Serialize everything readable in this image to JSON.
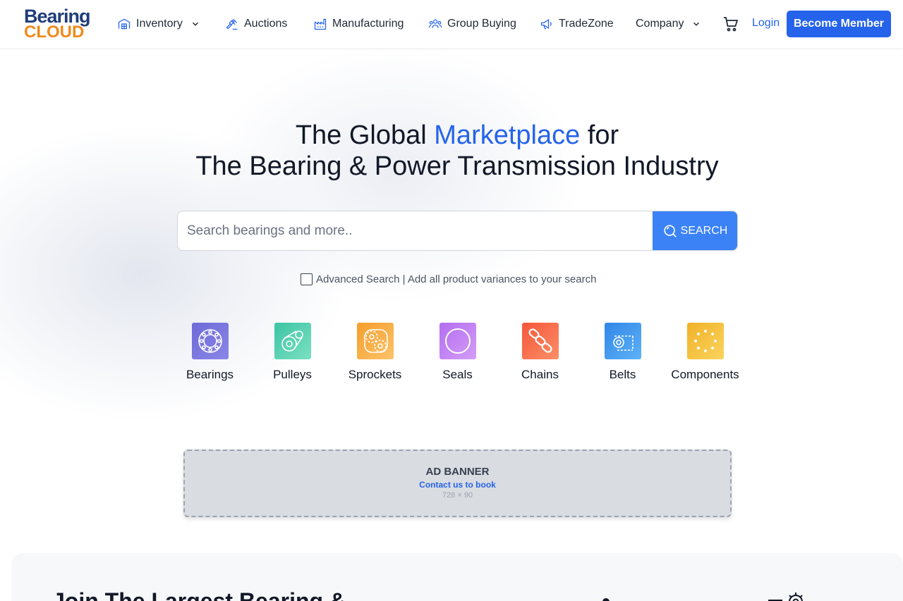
{
  "brand": {
    "top": "Bearing",
    "bottom": "CLOUD"
  },
  "nav": {
    "items": [
      {
        "label": "Inventory",
        "icon": "warehouse-icon",
        "has_dropdown": true
      },
      {
        "label": "Auctions",
        "icon": "gavel-icon",
        "has_dropdown": false
      },
      {
        "label": "Manufacturing",
        "icon": "factory-icon",
        "has_dropdown": false
      },
      {
        "label": "Group Buying",
        "icon": "group-icon",
        "has_dropdown": false
      },
      {
        "label": "TradeZone",
        "icon": "megaphone-icon",
        "has_dropdown": false
      },
      {
        "label": "Company",
        "icon": null,
        "has_dropdown": true
      }
    ],
    "cart_icon": "cart-icon",
    "login": "Login",
    "member": "Become Member"
  },
  "hero": {
    "line1_pre": "The Global ",
    "line1_accent": "Marketplace",
    "line1_post": " for",
    "line2": "The Bearing & Power Transmission Industry"
  },
  "search": {
    "placeholder": "Search bearings and more..",
    "value": "",
    "button": "SEARCH",
    "advanced_label": "Advanced Search | Add all product variances to your search",
    "advanced_checked": false
  },
  "categories": [
    {
      "label": "Bearings",
      "icon": "bearing-icon",
      "color_from": "#6d6ad8",
      "color_to": "#8b86e6"
    },
    {
      "label": "Pulleys",
      "icon": "pulley-icon",
      "color_from": "#3cc4a4",
      "color_to": "#7be0c2"
    },
    {
      "label": "Sprockets",
      "icon": "sprocket-icon",
      "color_from": "#f59e2b",
      "color_to": "#fcc36a"
    },
    {
      "label": "Seals",
      "icon": "seal-icon",
      "color_from": "#b36ef0",
      "color_to": "#d49cf7"
    },
    {
      "label": "Chains",
      "icon": "chain-icon",
      "color_from": "#f5563b",
      "color_to": "#fb8f66"
    },
    {
      "label": "Belts",
      "icon": "belt-icon",
      "color_from": "#2f86e8",
      "color_to": "#5fb2f7"
    },
    {
      "label": "Components",
      "icon": "components-icon",
      "color_from": "#f1b12a",
      "color_to": "#fad45c"
    }
  ],
  "ad": {
    "title": "AD BANNER",
    "link": "Contact us to book",
    "size": "728 × 90"
  },
  "join": {
    "title": "Join The Largest Bearing &"
  },
  "colors": {
    "accent": "#2563eb",
    "search_button": "#3b82f6",
    "brand_orange": "#f08a1c",
    "brand_navy": "#1f3d7a"
  }
}
